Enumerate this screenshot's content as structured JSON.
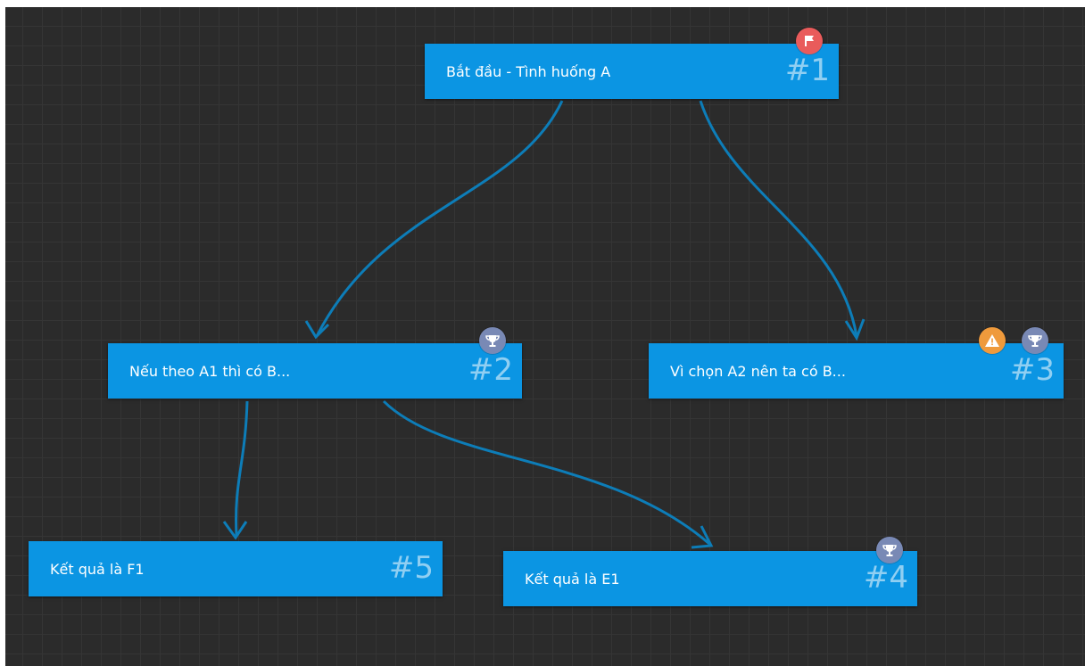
{
  "canvas": {
    "background": "#2b2b2b",
    "grid_color": "#353535",
    "edge_color": "#0d7db8",
    "node_color": "#0b95e3"
  },
  "nodes": [
    {
      "id": 1,
      "label": "Bắt đầu - Tình huống A",
      "number": "#1",
      "badges": [
        "start-flag-icon"
      ]
    },
    {
      "id": 2,
      "label": "Nếu theo A1 thì có B...",
      "number": "#2",
      "badges": [
        "trophy-icon"
      ]
    },
    {
      "id": 3,
      "label": "Vì chọn A2 nên ta có B...",
      "number": "#3",
      "badges": [
        "warning-icon",
        "trophy-icon"
      ]
    },
    {
      "id": 4,
      "label": "Kết quả là E1",
      "number": "#4",
      "badges": [
        "trophy-icon"
      ]
    },
    {
      "id": 5,
      "label": "Kết quả là F1",
      "number": "#5",
      "badges": []
    }
  ],
  "edges": [
    {
      "from": 1,
      "to": 2
    },
    {
      "from": 1,
      "to": 3
    },
    {
      "from": 2,
      "to": 5
    },
    {
      "from": 2,
      "to": 4
    }
  ]
}
